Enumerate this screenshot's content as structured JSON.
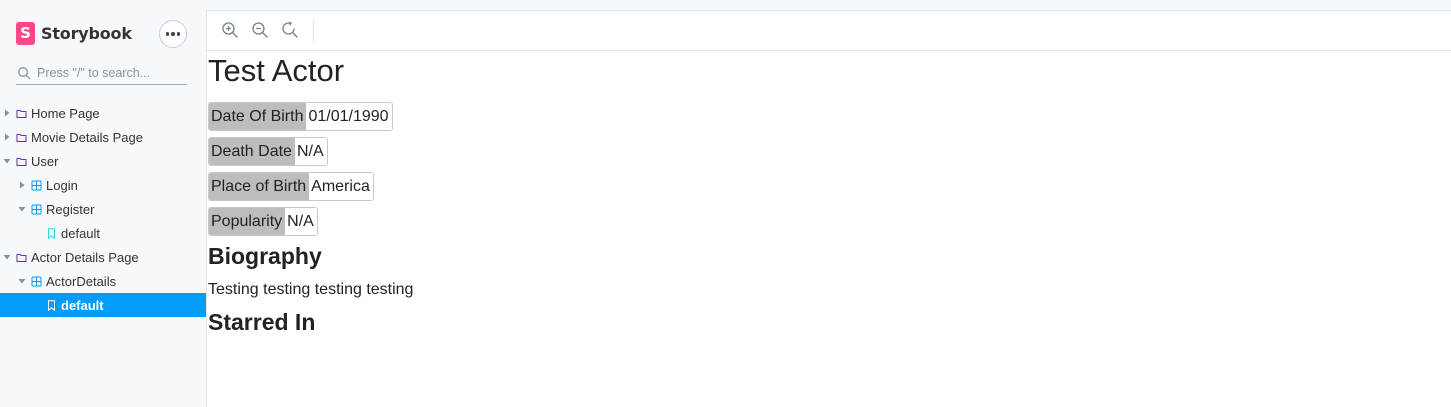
{
  "brand": {
    "name": "Storybook",
    "logo_letter": "S",
    "logo_color": "#ff4785"
  },
  "sidebar": {
    "search_placeholder": "Press \"/\" to search...",
    "tree": [
      {
        "label": "Home Page",
        "kind": "folder",
        "level": 0,
        "expanded": false,
        "selected": false
      },
      {
        "label": "Movie Details Page",
        "kind": "folder",
        "level": 0,
        "expanded": false,
        "selected": false
      },
      {
        "label": "User",
        "kind": "folder",
        "level": 0,
        "expanded": true,
        "selected": false
      },
      {
        "label": "Login",
        "kind": "component",
        "level": 1,
        "expanded": false,
        "selected": false
      },
      {
        "label": "Register",
        "kind": "component",
        "level": 1,
        "expanded": true,
        "selected": false
      },
      {
        "label": "default",
        "kind": "story",
        "level": 2,
        "expanded": false,
        "selected": false
      },
      {
        "label": "Actor Details Page",
        "kind": "folder",
        "level": 0,
        "expanded": true,
        "selected": false
      },
      {
        "label": "ActorDetails",
        "kind": "component",
        "level": 1,
        "expanded": true,
        "selected": false
      },
      {
        "label": "default",
        "kind": "story",
        "level": 2,
        "expanded": false,
        "selected": true
      }
    ],
    "selected_color": "#029cfd"
  },
  "toolbar": {
    "buttons": [
      {
        "name": "zoom-in-icon"
      },
      {
        "name": "zoom-out-icon"
      },
      {
        "name": "reset-zoom-icon"
      }
    ]
  },
  "preview": {
    "actor_name": "Test Actor",
    "facts": [
      {
        "label": "Date Of Birth",
        "value": "01/01/1990"
      },
      {
        "label": "Death Date",
        "value": "N/A"
      },
      {
        "label": "Place of Birth",
        "value": "America"
      },
      {
        "label": "Popularity",
        "value": "N/A"
      }
    ],
    "biography_title": "Biography",
    "biography_text": "Testing testing testing testing",
    "starred_in_title": "Starred In"
  }
}
